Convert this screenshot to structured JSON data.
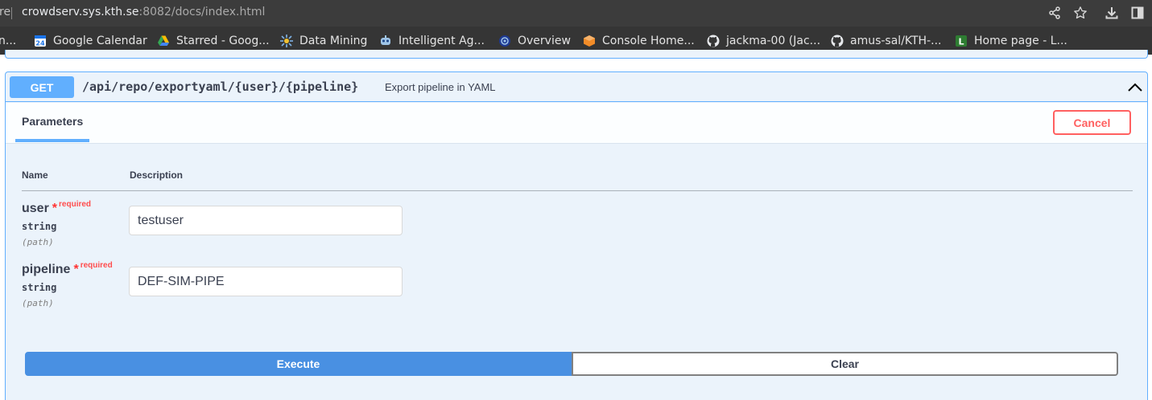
{
  "browser": {
    "url_prefix": "re",
    "url_host": "crowdserv.sys.kth.se",
    "url_rest": ":8082/docs/index.html",
    "actions": [
      "share-icon",
      "star-icon",
      "download-icon",
      "sidepanel-icon"
    ]
  },
  "bookmarks": [
    {
      "label": "n...",
      "icon": "none"
    },
    {
      "label": "Google Calendar",
      "icon": "calendar-icon",
      "color": "#1a73e8",
      "badge": "24"
    },
    {
      "label": "Starred - Goog...",
      "icon": "drive-icon"
    },
    {
      "label": "Data Mining",
      "icon": "data-mining-icon",
      "color": "#7fb3e6"
    },
    {
      "label": "Intelligent Ag...",
      "icon": "robot-icon",
      "color": "#9fc5e8"
    },
    {
      "label": "Overview",
      "icon": "overview-icon",
      "color": "#5b8def"
    },
    {
      "label": "Console Home...",
      "icon": "aws-cube-icon",
      "color": "#f28c28"
    },
    {
      "label": "jackma-00 (Jac...",
      "icon": "github-icon"
    },
    {
      "label": "amus-sal/KTH-...",
      "icon": "github-icon"
    },
    {
      "label": "Home page - L...",
      "icon": "L-icon",
      "color": "#2e7d32",
      "badge": "L"
    }
  ],
  "operation": {
    "method": "GET",
    "path": "/api/repo/exportyaml/{user}/{pipeline}",
    "description": "Export pipeline in YAML",
    "method_color": "#61affe"
  },
  "section": {
    "tab_label": "Parameters",
    "cancel_label": "Cancel"
  },
  "table": {
    "col_name": "Name",
    "col_description": "Description"
  },
  "parameters": [
    {
      "name": "user",
      "star": "*",
      "required": "required",
      "type": "string",
      "in": "(path)",
      "value": "testuser"
    },
    {
      "name": "pipeline",
      "star": "*",
      "required": "required",
      "type": "string",
      "in": "(path)",
      "value": "DEF-SIM-PIPE"
    }
  ],
  "actions": {
    "execute_label": "Execute",
    "clear_label": "Clear",
    "execute_color": "#4990e2"
  }
}
